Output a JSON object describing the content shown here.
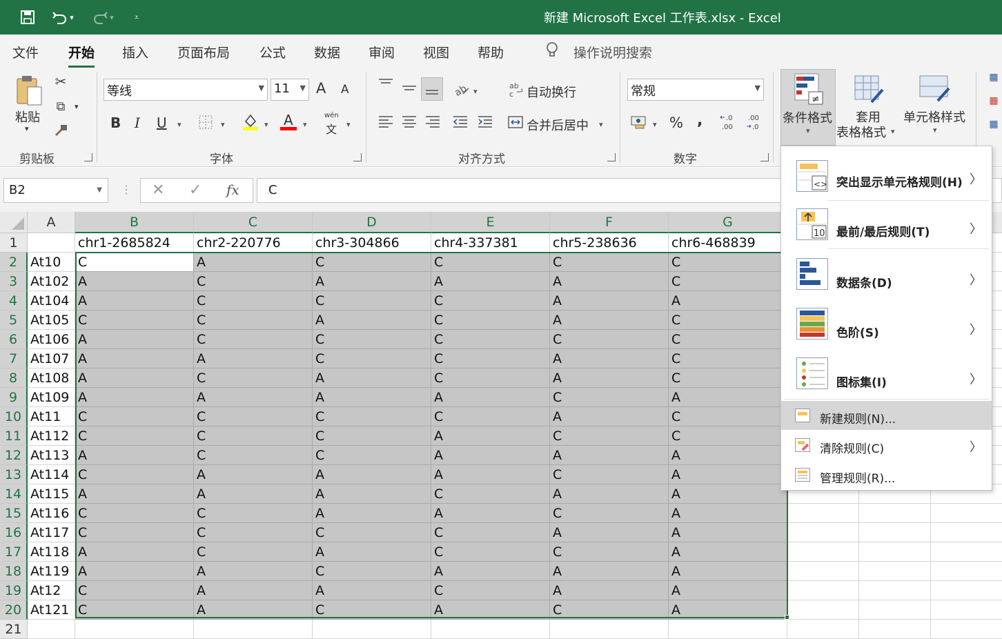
{
  "titlebar": {
    "title": "新建 Microsoft Excel 工作表.xlsx  -  Excel",
    "icons": [
      "save-icon",
      "undo-icon",
      "redo-icon",
      "customize-quick-access-icon"
    ]
  },
  "menu": {
    "tabs": [
      "文件",
      "开始",
      "插入",
      "页面布局",
      "公式",
      "数据",
      "审阅",
      "视图",
      "帮助"
    ],
    "active": "开始",
    "search_label": "操作说明搜索"
  },
  "ribbon": {
    "clipboard": {
      "paste": "粘贴",
      "group": "剪贴板"
    },
    "font": {
      "name": "等线",
      "size": "11",
      "bold": "B",
      "italic": "I",
      "underline": "U",
      "wen": "wén",
      "wen_char": "文",
      "grow": "A",
      "shrink": "A",
      "group": "字体",
      "fill_color": "#ffff00",
      "font_color": "#ff0000"
    },
    "alignment": {
      "wrap": "自动换行",
      "merge": "合并后居中",
      "group": "对齐方式"
    },
    "number": {
      "format": "常规",
      "percent": "%",
      "comma": ",",
      "inc_decimal": "←.0 .00",
      "dec_decimal": ".00 →.0",
      "group": "数字"
    },
    "styles": {
      "conditional": "条件格式",
      "table_line1": "套用",
      "table_line2": "表格格式",
      "cell_styles": "单元格样式"
    }
  },
  "formula_bar": {
    "name_box": "B2",
    "cancel": "✕",
    "enter": "✓",
    "fx": "fx",
    "content": "C"
  },
  "sheet": {
    "columns": [
      "A",
      "B",
      "C",
      "D",
      "E",
      "F",
      "G"
    ],
    "header_row": [
      "",
      "chr1-2685824",
      "chr2-220776",
      "chr3-304866",
      "chr4-337381",
      "chr5-238636",
      "chr6-468839"
    ],
    "rows": [
      [
        "At10",
        "C",
        "A",
        "C",
        "C",
        "C",
        "C"
      ],
      [
        "At102",
        "A",
        "C",
        "A",
        "A",
        "A",
        "C"
      ],
      [
        "At104",
        "A",
        "C",
        "C",
        "C",
        "A",
        "A"
      ],
      [
        "At105",
        "C",
        "C",
        "A",
        "C",
        "A",
        "C"
      ],
      [
        "At106",
        "A",
        "C",
        "C",
        "C",
        "C",
        "C"
      ],
      [
        "At107",
        "A",
        "A",
        "C",
        "C",
        "A",
        "C"
      ],
      [
        "At108",
        "A",
        "C",
        "A",
        "C",
        "A",
        "C"
      ],
      [
        "At109",
        "A",
        "A",
        "A",
        "A",
        "C",
        "A"
      ],
      [
        "At11",
        "C",
        "C",
        "C",
        "C",
        "A",
        "C"
      ],
      [
        "At112",
        "C",
        "C",
        "C",
        "A",
        "C",
        "C"
      ],
      [
        "At113",
        "A",
        "C",
        "C",
        "A",
        "A",
        "A"
      ],
      [
        "At114",
        "C",
        "A",
        "A",
        "A",
        "C",
        "A"
      ],
      [
        "At115",
        "A",
        "A",
        "A",
        "C",
        "A",
        "A"
      ],
      [
        "At116",
        "C",
        "C",
        "A",
        "A",
        "C",
        "A"
      ],
      [
        "At117",
        "C",
        "C",
        "C",
        "C",
        "A",
        "A"
      ],
      [
        "At118",
        "A",
        "C",
        "A",
        "C",
        "C",
        "A"
      ],
      [
        "At119",
        "A",
        "A",
        "C",
        "A",
        "A",
        "A"
      ],
      [
        "At12",
        "C",
        "A",
        "A",
        "C",
        "A",
        "A"
      ],
      [
        "At121",
        "C",
        "A",
        "C",
        "A",
        "C",
        "A"
      ]
    ],
    "row_numbers": [
      "1",
      "2",
      "3",
      "4",
      "5",
      "6",
      "7",
      "8",
      "9",
      "10",
      "11",
      "12",
      "13",
      "14",
      "15",
      "16",
      "17",
      "18",
      "19",
      "20",
      "21"
    ]
  },
  "conditional_menu": {
    "items": [
      {
        "label": "突出显示单元格规则(H)",
        "icon": "highlight-rules-icon",
        "submenu": true
      },
      {
        "label": "最前/最后规则(T)",
        "icon": "top-bottom-rules-icon",
        "submenu": true
      },
      {
        "label": "数据条(D)",
        "icon": "data-bars-icon",
        "submenu": true
      },
      {
        "label": "色阶(S)",
        "icon": "color-scales-icon",
        "submenu": true
      },
      {
        "label": "图标集(I)",
        "icon": "icon-sets-icon",
        "submenu": true
      }
    ],
    "small_items": [
      {
        "label": "新建规则(N)...",
        "icon": "new-rule-icon",
        "submenu": false
      },
      {
        "label": "清除规则(C)",
        "icon": "clear-rules-icon",
        "submenu": true
      },
      {
        "label": "管理规则(R)...",
        "icon": "manage-rules-icon",
        "submenu": false
      }
    ],
    "top10_badge": "10",
    "neq_badge": "≠",
    "lt_gt_badge": "<>"
  },
  "colors": {
    "accent": "#217346",
    "selection": "#c6c6c6"
  }
}
